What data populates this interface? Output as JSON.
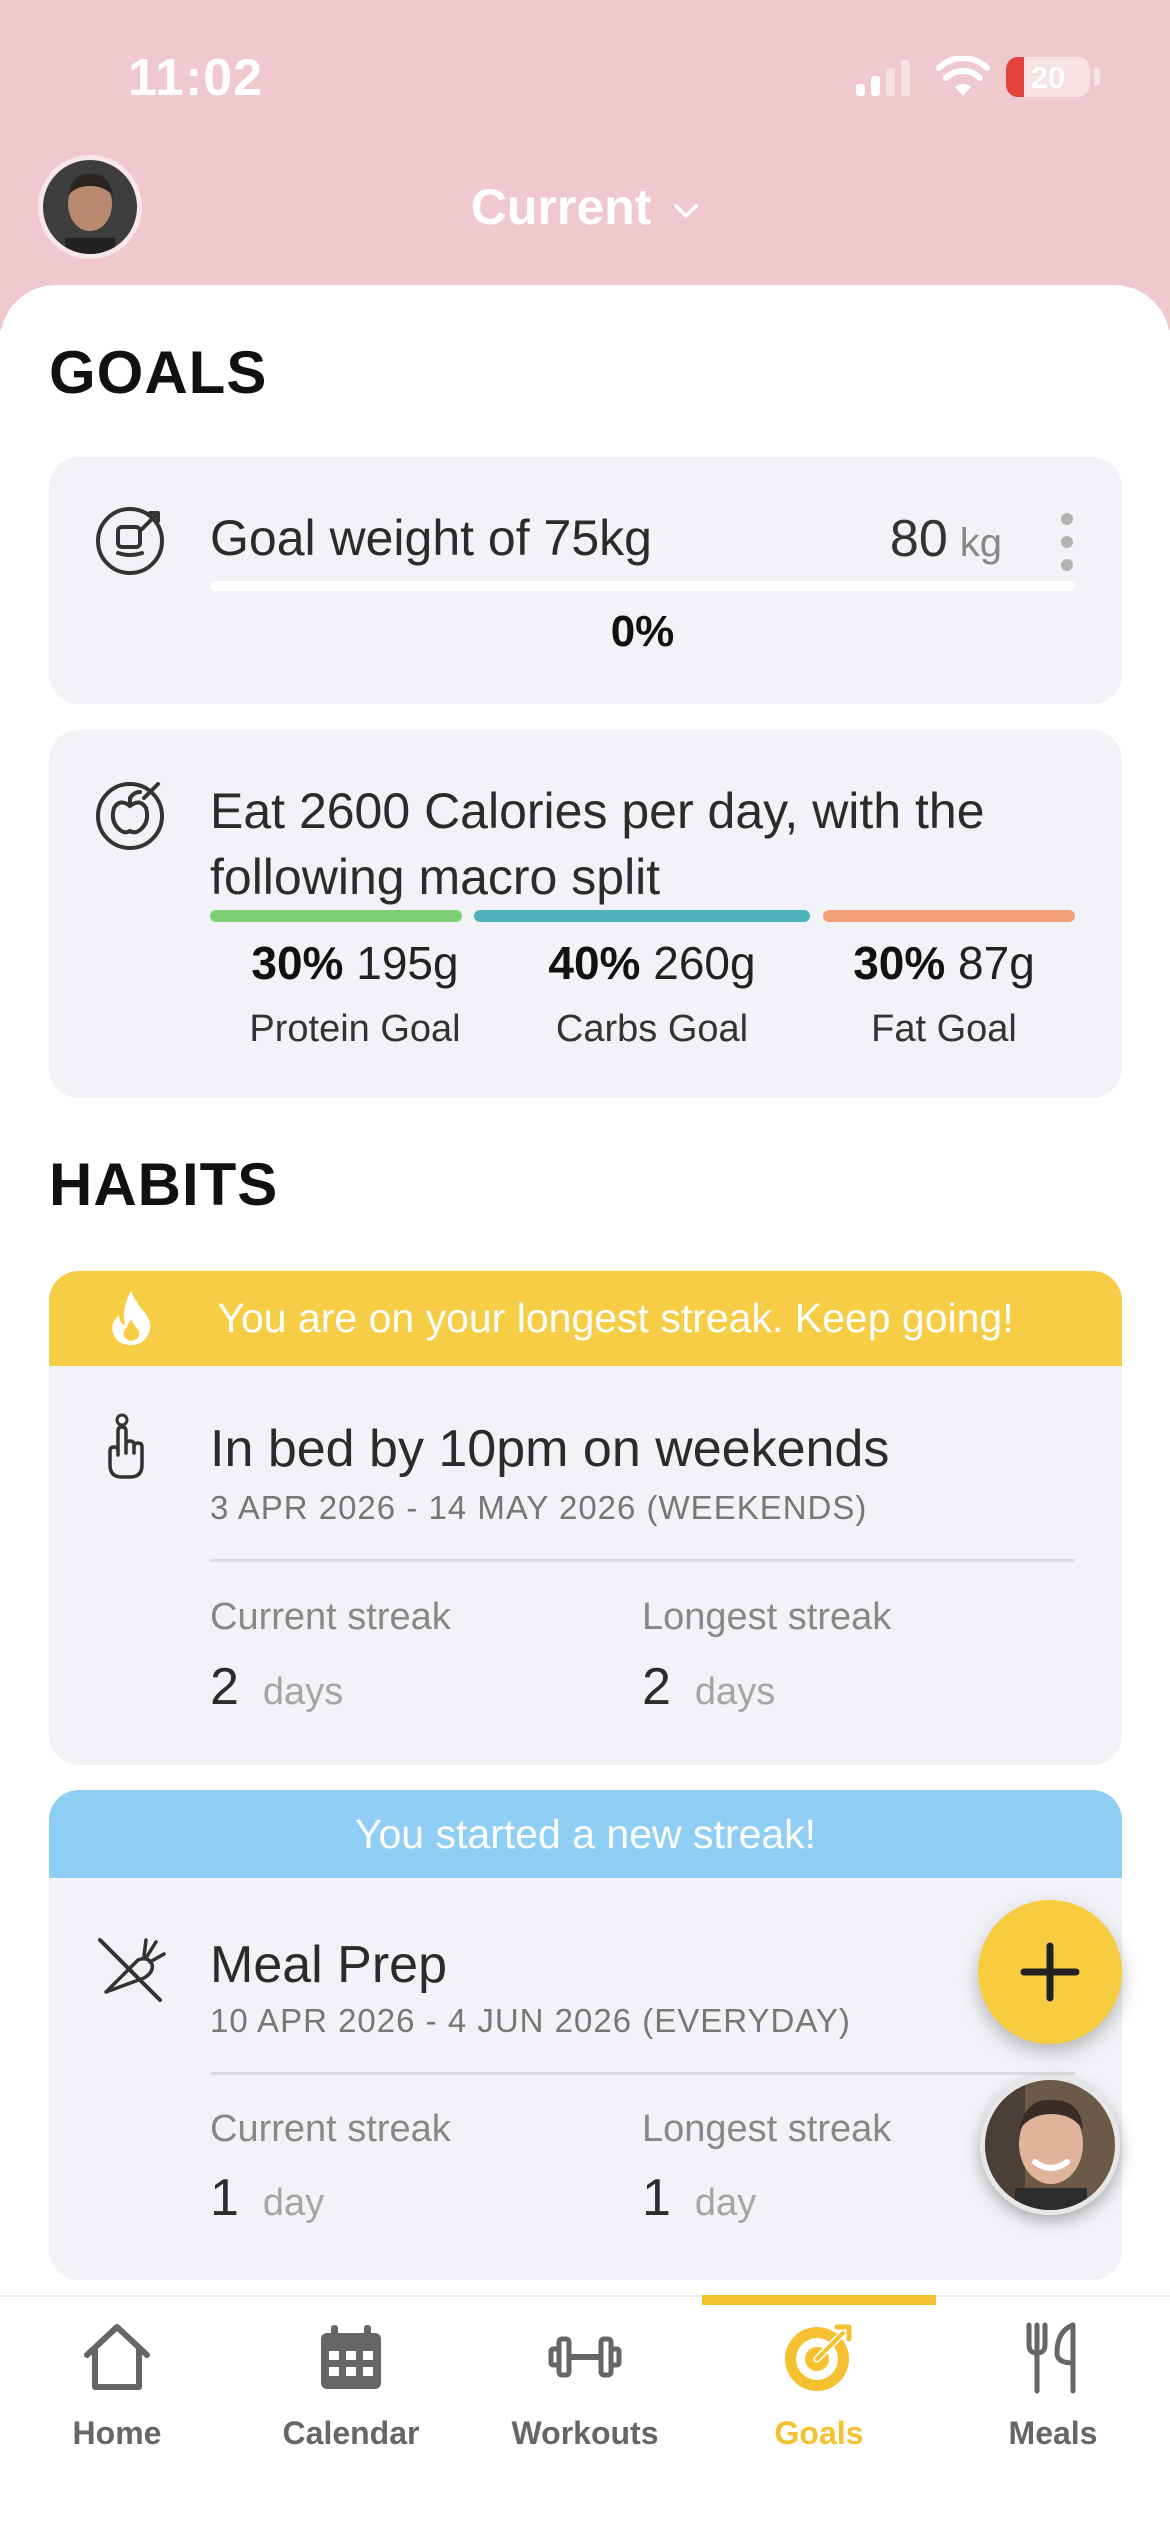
{
  "status_bar": {
    "time": "11:02",
    "battery": "20"
  },
  "header": {
    "title": "Current"
  },
  "goals": {
    "heading": "GOALS",
    "weight": {
      "title": "Goal weight of 75kg",
      "current_value": "80",
      "unit": "kg",
      "progress_percent": "0%"
    },
    "calories": {
      "title_line1": "Eat 2600 Calories per day, with the",
      "title_line2": "following macro split",
      "macros": [
        {
          "percent": "30%",
          "grams": "195g",
          "label": "Protein Goal",
          "color": "#7fcf76"
        },
        {
          "percent": "40%",
          "grams": "260g",
          "label": "Carbs Goal",
          "color": "#4fb3bd"
        },
        {
          "percent": "30%",
          "grams": "87g",
          "label": "Fat Goal",
          "color": "#f2a079"
        }
      ]
    }
  },
  "habits": {
    "heading": "HABITS",
    "items": [
      {
        "banner": "You are on your longest streak. Keep going!",
        "banner_color": "#f6cd44",
        "title": "In bed by 10pm on weekends",
        "dates": "3 APR 2026 - 14 MAY 2026 (WEEKENDS)",
        "current_label": "Current streak",
        "current_value": "2",
        "current_unit": "days",
        "longest_label": "Longest streak",
        "longest_value": "2",
        "longest_unit": "days"
      },
      {
        "banner": "You started a new streak!",
        "banner_color": "#8fcff5",
        "title": "Meal Prep",
        "dates": "10 APR 2026 - 4 JUN 2026 (EVERYDAY)",
        "current_label": "Current streak",
        "current_value": "1",
        "current_unit": "day",
        "longest_label": "Longest streak",
        "longest_value": "1",
        "longest_unit": "day"
      }
    ]
  },
  "tabbar": {
    "tabs": [
      {
        "label": "Home",
        "icon": "home-icon"
      },
      {
        "label": "Calendar",
        "icon": "calendar-icon"
      },
      {
        "label": "Workouts",
        "icon": "dumbbell-icon"
      },
      {
        "label": "Goals",
        "icon": "target-icon",
        "active": true
      },
      {
        "label": "Meals",
        "icon": "fork-knife-icon"
      }
    ]
  },
  "colors": {
    "header_pink": "#efc9ce",
    "accent_yellow": "#f5c130",
    "card_bg": "#f2f3f6"
  }
}
